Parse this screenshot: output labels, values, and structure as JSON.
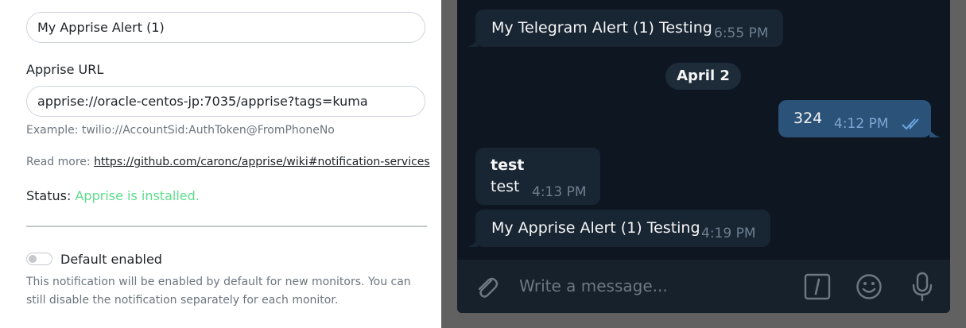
{
  "modal": {
    "name_value": "My Apprise Alert (1)",
    "apprise_url_label": "Apprise URL",
    "apprise_url_value": "apprise://oracle-centos-jp:7035/apprise?tags=kuma",
    "example_text": "Example: twilio://AccountSid:AuthToken@FromPhoneNo",
    "read_more_label": "Read more:",
    "read_more_link": "https://github.com/caronc/apprise/wiki#notification-services",
    "status_label": "Status:",
    "status_value": "Apprise is installed.",
    "default_enabled_label": "Default enabled",
    "default_enabled_on": false,
    "description": "This notification will be enabled by default for new monitors. You can still disable the notification separately for each monitor."
  },
  "telegram": {
    "messages": [
      {
        "text": "My Telegram Alert (1) Testing",
        "time": "6:55 PM",
        "direction": "in"
      },
      {
        "text": "324",
        "time": "4:12 PM",
        "direction": "out"
      },
      {
        "title": "test",
        "text": "test",
        "time": "4:13 PM",
        "direction": "in"
      },
      {
        "text": "My Apprise Alert (1) Testing",
        "time": "4:19 PM",
        "direction": "in"
      }
    ],
    "date_separator": "April 2",
    "composer_placeholder": "Write a message...",
    "icons": [
      "attach-icon",
      "bot-command-icon",
      "emoji-icon",
      "microphone-icon",
      "read-receipt-icon"
    ]
  },
  "colors": {
    "status_ok": "#5cdd8b",
    "chat_bg": "#0e1621",
    "bubble_in": "#182533",
    "bubble_out": "#2b5278"
  }
}
